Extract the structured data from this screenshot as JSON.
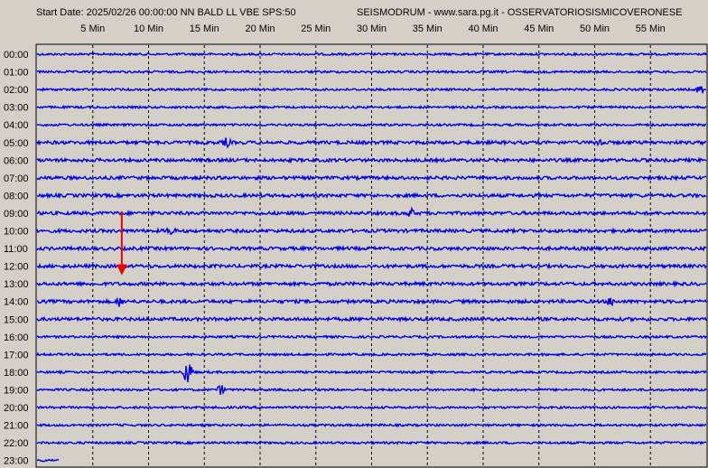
{
  "header": {
    "left": "Start Date: 2025/02/26 00:00:00 NN BALD LL VBE SPS:50",
    "right": "SEISMODRUM - www.sara.pg.it - OSSERVATORIOSISMICOVERONESE"
  },
  "colors": {
    "background": "#d4d0c8",
    "trace": "#0000e6",
    "grid": "#000000",
    "marker": "#ee0000"
  },
  "chart_data": {
    "type": "line",
    "title": "",
    "xlabel": "",
    "ylabel": "",
    "x_unit": "minutes",
    "xlim": [
      0,
      60
    ],
    "x_ticks": [
      5,
      10,
      15,
      20,
      25,
      30,
      35,
      40,
      45,
      50,
      55
    ],
    "x_tick_labels": [
      "5 Min",
      "10 Min",
      "15 Min",
      "20 Min",
      "25 Min",
      "30 Min",
      "35 Min",
      "40 Min",
      "45 Min",
      "50 Min",
      "55 Min"
    ],
    "grid": true,
    "grid_style": "dashed vertical",
    "rows": [
      {
        "label": "00:00"
      },
      {
        "label": "01:00"
      },
      {
        "label": "02:00"
      },
      {
        "label": "03:00"
      },
      {
        "label": "04:00"
      },
      {
        "label": "05:00"
      },
      {
        "label": "06:00"
      },
      {
        "label": "07:00"
      },
      {
        "label": "08:00"
      },
      {
        "label": "09:00"
      },
      {
        "label": "10:00"
      },
      {
        "label": "11:00"
      },
      {
        "label": "12:00"
      },
      {
        "label": "13:00"
      },
      {
        "label": "14:00"
      },
      {
        "label": "15:00"
      },
      {
        "label": "16:00"
      },
      {
        "label": "17:00"
      },
      {
        "label": "18:00"
      },
      {
        "label": "19:00"
      },
      {
        "label": "20:00"
      },
      {
        "label": "21:00"
      },
      {
        "label": "22:00"
      },
      {
        "label": "23:00"
      }
    ],
    "last_row_end_minute": 2,
    "events": [
      {
        "row": "18:00",
        "minute": 13.5,
        "note": "largest spike"
      },
      {
        "row": "14:00",
        "minute": 7.4
      },
      {
        "row": "14:00",
        "minute": 51.5
      },
      {
        "row": "10:00",
        "minute": 12
      },
      {
        "row": "09:00",
        "minute": 33.5
      },
      {
        "row": "19:00",
        "minute": 16.5
      },
      {
        "row": "05:00",
        "minute": 50.5
      },
      {
        "row": "05:00",
        "minute": 17
      },
      {
        "row": "02:00",
        "minute": 59.5
      }
    ],
    "marker": {
      "type": "arrow",
      "minute": 7.6,
      "from_row": "09:00",
      "to_row": "12:00"
    }
  }
}
